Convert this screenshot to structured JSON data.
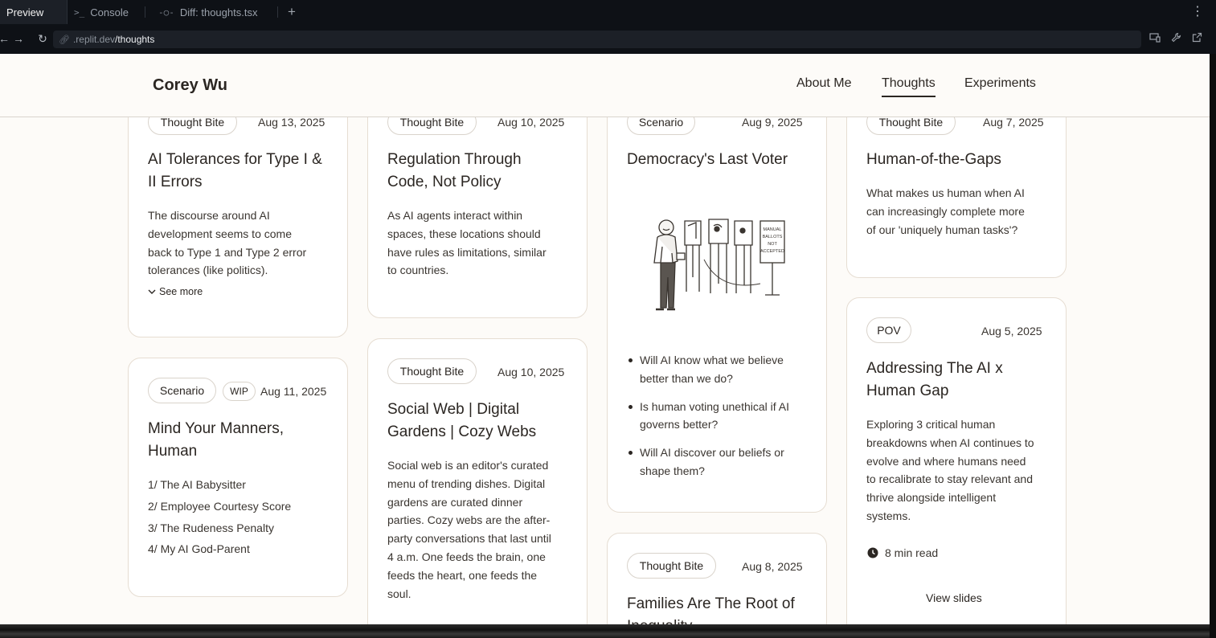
{
  "ide": {
    "tabs": [
      {
        "label": "Preview",
        "icon": "preview-icon"
      },
      {
        "label": "Console",
        "icon": "console-icon"
      },
      {
        "label": "Diff: thoughts.tsx",
        "icon": "diff-icon"
      }
    ],
    "url_host": ".replit.dev",
    "url_path": "/thoughts"
  },
  "site": {
    "name": "Corey Wu",
    "nav": [
      "About Me",
      "Thoughts",
      "Experiments"
    ]
  },
  "cards": {
    "c1": {
      "tag": "Thought Bite",
      "date": "Aug 13, 2025",
      "title": [
        "AI Tolerances for Type I &",
        "II Errors"
      ],
      "body": [
        "The discourse around AI",
        "development seems to come",
        "back to Type 1 and Type 2 error",
        "tolerances (like politics)."
      ],
      "see_more": "See more"
    },
    "c2": {
      "tags": [
        "Scenario",
        "WIP"
      ],
      "date": "Aug 11, 2025",
      "title": [
        "Mind Your Manners,",
        "Human"
      ],
      "list": [
        "1/ The AI Babysitter",
        "2/ Employee Courtesy Score",
        "3/ The Rudeness Penalty",
        "4/ My AI God-Parent"
      ]
    },
    "c3": {
      "tag": "Thought Bite",
      "date": "Aug 10, 2025",
      "title": [
        "Regulation Through",
        "Code, Not Policy"
      ],
      "body": [
        "As AI agents interact within",
        "spaces, these locations should",
        "have rules as limitations, similar",
        "to countries."
      ]
    },
    "c4": {
      "tag": "Thought Bite",
      "date": "Aug 10, 2025",
      "title": [
        "Social Web | Digital",
        "Gardens | Cozy Webs"
      ],
      "body": [
        "Social web is an editor's curated",
        "menu of trending dishes. Digital",
        "gardens are curated dinner",
        "parties. Cozy webs are the after-",
        "party conversations that last until",
        "4 a.m. One feeds the brain, one",
        "feeds the heart, one feeds the",
        "soul."
      ]
    },
    "c5": {
      "tag": "Scenario",
      "date": "Aug 9, 2025",
      "title": [
        "Democracy's Last Voter"
      ],
      "sign_text": [
        "MANUAL",
        "BALLOTS",
        "NOT",
        "ACCEPTED"
      ],
      "bullets": [
        [
          "Will AI know what we believe",
          "better than we do?"
        ],
        [
          "Is human voting unethical if AI",
          "governs better?"
        ],
        [
          "Will AI discover our beliefs or",
          "shape them?"
        ]
      ]
    },
    "c6": {
      "tag": "Thought Bite",
      "date": "Aug 8, 2025",
      "title": [
        "Families Are The Root of",
        "Inequality"
      ]
    },
    "c7": {
      "tag": "Thought Bite",
      "date": "Aug 7, 2025",
      "title": [
        "Human-of-the-Gaps"
      ],
      "body": [
        "What makes us human when AI",
        "can increasingly complete more",
        "of our 'uniquely human tasks'?"
      ]
    },
    "c8": {
      "tag": "POV",
      "date": "Aug 5, 2025",
      "title": [
        "Addressing The AI x",
        "Human Gap"
      ],
      "body": [
        "Exploring 3 critical human",
        "breakdowns when AI continues to",
        "evolve and where humans need",
        "to recalibrate to stay relevant and",
        "thrive alongside intelligent",
        "systems."
      ],
      "read_time": "8 min read",
      "view_slides": "View slides"
    }
  }
}
